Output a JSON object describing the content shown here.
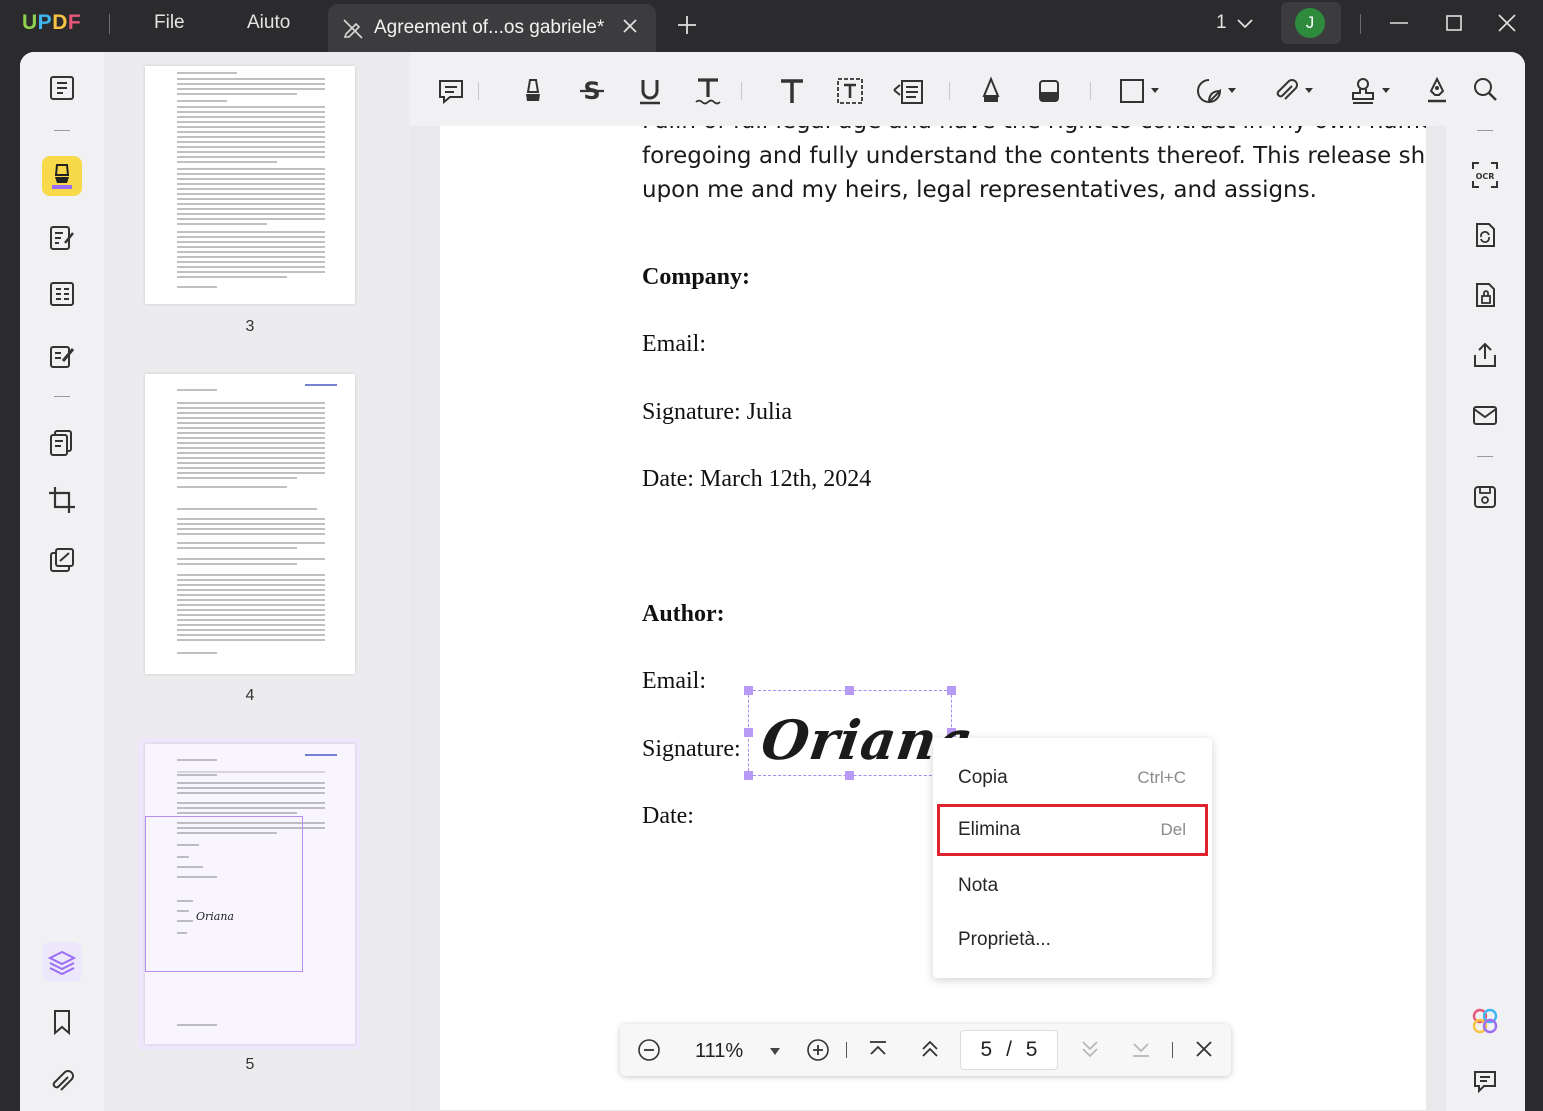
{
  "titlebar": {
    "logo": "UPDF",
    "menu": [
      "File",
      "Aiuto"
    ],
    "tab_title": "Agreement of...os gabriele*",
    "page_count": "1",
    "user_initial": "J"
  },
  "toolbar": {
    "tools": [
      "comment-icon",
      "highlight-icon",
      "strikethrough-icon",
      "underline-icon",
      "squiggly-icon",
      "text-icon",
      "textbox-icon",
      "text-callout-icon",
      "pencil-icon",
      "eraser-icon",
      "shape-icon",
      "sticker-icon",
      "attachment-icon",
      "stamp-icon",
      "signature-icon"
    ]
  },
  "thumbnails": [
    {
      "page_label": "3"
    },
    {
      "page_label": "4"
    },
    {
      "page_label": "5",
      "selected": true,
      "mini_signature": "Oriana"
    }
  ],
  "document": {
    "para_line1": "Fulln of full legal age and have the right to contract in my own name. I hav",
    "para_line2": "foregoing and fully understand the contents thereof. This release shall be",
    "para_line3": "upon me and my heirs, legal representatives, and assigns.",
    "company_heading": "Company:",
    "company_email": "Email:",
    "company_signature": "Signature: Julia",
    "company_date": "Date: March 12th, 2024",
    "author_heading": "Author:",
    "author_email": "Email:",
    "author_signature_label": "Signature:",
    "author_signature_value": "Oriana",
    "author_date": "Date:"
  },
  "context_menu": {
    "items": [
      {
        "label": "Copia",
        "shortcut": "Ctrl+C"
      },
      {
        "label": "Elimina",
        "shortcut": "Del",
        "highlighted": true
      },
      {
        "label": "Nota",
        "shortcut": ""
      },
      {
        "label": "Proprietà...",
        "shortcut": ""
      }
    ]
  },
  "zoombar": {
    "zoom": "111%",
    "current_page": "5",
    "separator": "/",
    "total_pages": "5"
  },
  "colors": {
    "accent": "#9b6cf4",
    "highlight_border": "#e0212e",
    "active_tool": "#f7d94a",
    "titlebar": "#2b2b2d"
  }
}
